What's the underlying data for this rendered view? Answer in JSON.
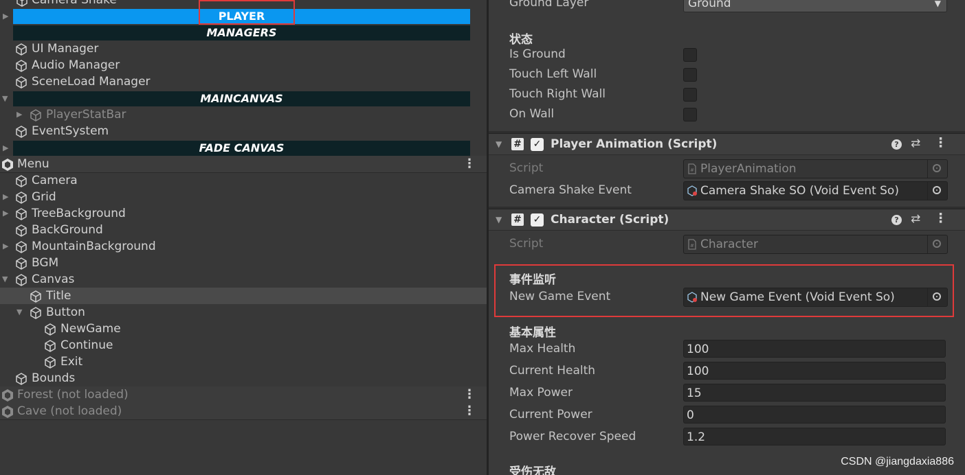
{
  "hierarchy": {
    "top_partial": "Camera Shake",
    "bars": {
      "player": "PLAYER",
      "managers": "MANAGERS",
      "maincanvas": "MAINCANVAS",
      "fade_canvas": "FADE CANVAS"
    },
    "managers_items": [
      "UI Manager",
      "Audio Manager",
      "SceneLoad Manager"
    ],
    "player_stat_bar": "PlayerStatBar",
    "event_system": "EventSystem",
    "menu_scene": "Menu",
    "menu_items": [
      "Camera",
      "Grid",
      "TreeBackground",
      "BackGround",
      "MountainBackground",
      "BGM",
      "Canvas"
    ],
    "canvas_children": {
      "title": "Title",
      "button": "Button"
    },
    "button_children": [
      "NewGame",
      "Continue",
      "Exit"
    ],
    "bounds": "Bounds",
    "unloaded_scenes": [
      "Forest (not loaded)",
      "Cave (not loaded)"
    ]
  },
  "inspector": {
    "ground_layer": {
      "label": "Ground Layer",
      "value": "Ground"
    },
    "state_section": {
      "title": "状态",
      "fields": [
        "Is Ground",
        "Touch Left Wall",
        "Touch Right Wall",
        "On Wall"
      ]
    },
    "player_animation": {
      "title": "Player Animation (Script)",
      "script_label": "Script",
      "script_value": "PlayerAnimation",
      "camera_event_label": "Camera Shake Event",
      "camera_event_value": "Camera Shake SO (Void Event So)"
    },
    "character": {
      "title": "Character (Script)",
      "script_label": "Script",
      "script_value": "Character",
      "event_section_title": "事件监听",
      "new_game_event_label": "New Game Event",
      "new_game_event_value": "New Game Event (Void Event So)",
      "base_section_title": "基本属性",
      "stats": [
        {
          "label": "Max Health",
          "value": "100"
        },
        {
          "label": "Current Health",
          "value": "100"
        },
        {
          "label": "Max Power",
          "value": "15"
        },
        {
          "label": "Current Power",
          "value": "0"
        },
        {
          "label": "Power Recover Speed",
          "value": "1.2"
        }
      ],
      "invincible_section_title": "受伤无敌"
    }
  },
  "icons": {
    "script": "#",
    "checkmark": "✓",
    "help": "?",
    "presets": "⇄",
    "more": "⋮",
    "caret": "▼"
  },
  "watermark": "CSDN @jiangdaxia886",
  "colors": {
    "selection": "#0a97f0",
    "header_bar": "#0d2226",
    "highlight": "#e03a3a"
  }
}
